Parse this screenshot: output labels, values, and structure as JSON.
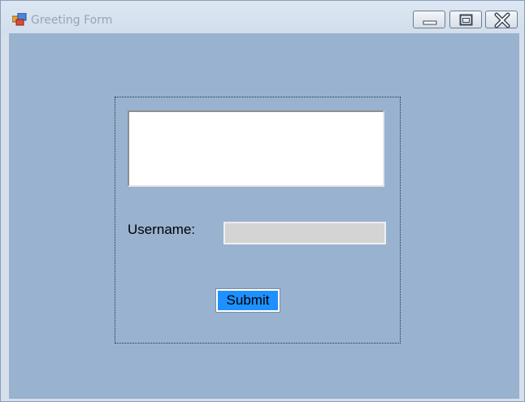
{
  "window": {
    "title": "Greeting Form",
    "icon": "app-window-icon",
    "controls": {
      "minimize": "minimize-icon",
      "maximize": "maximize-icon",
      "close": "close-icon"
    }
  },
  "form": {
    "message_box_value": "",
    "username_label": "Username:",
    "username_value": "",
    "submit_label": "Submit"
  },
  "colors": {
    "client_background": "#98b2d0",
    "submit_background": "#1e90ff",
    "username_field_background": "#d4d4d4"
  }
}
